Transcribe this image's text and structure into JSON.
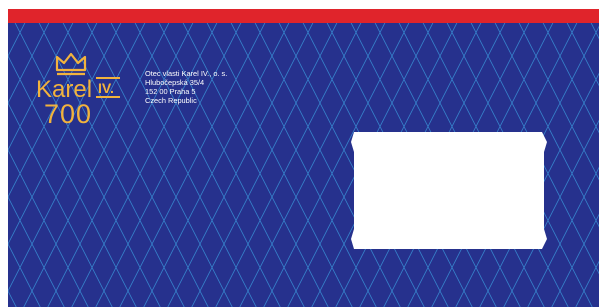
{
  "colors": {
    "background": "#26318d",
    "stripe": "#e0242b",
    "pattern": "#3b9fe0",
    "logo": "#f2b33d",
    "window": "#ffffff"
  },
  "logo": {
    "name": "Karel",
    "numeral": "IV.",
    "number": "700",
    "icon": "crown-icon"
  },
  "sender": {
    "line1": "Otec vlasti Karel IV., o. s.",
    "line2": "Hlubočepská 35/4",
    "line3": "152 00 Praha 5",
    "line4": "Czech Republic"
  }
}
